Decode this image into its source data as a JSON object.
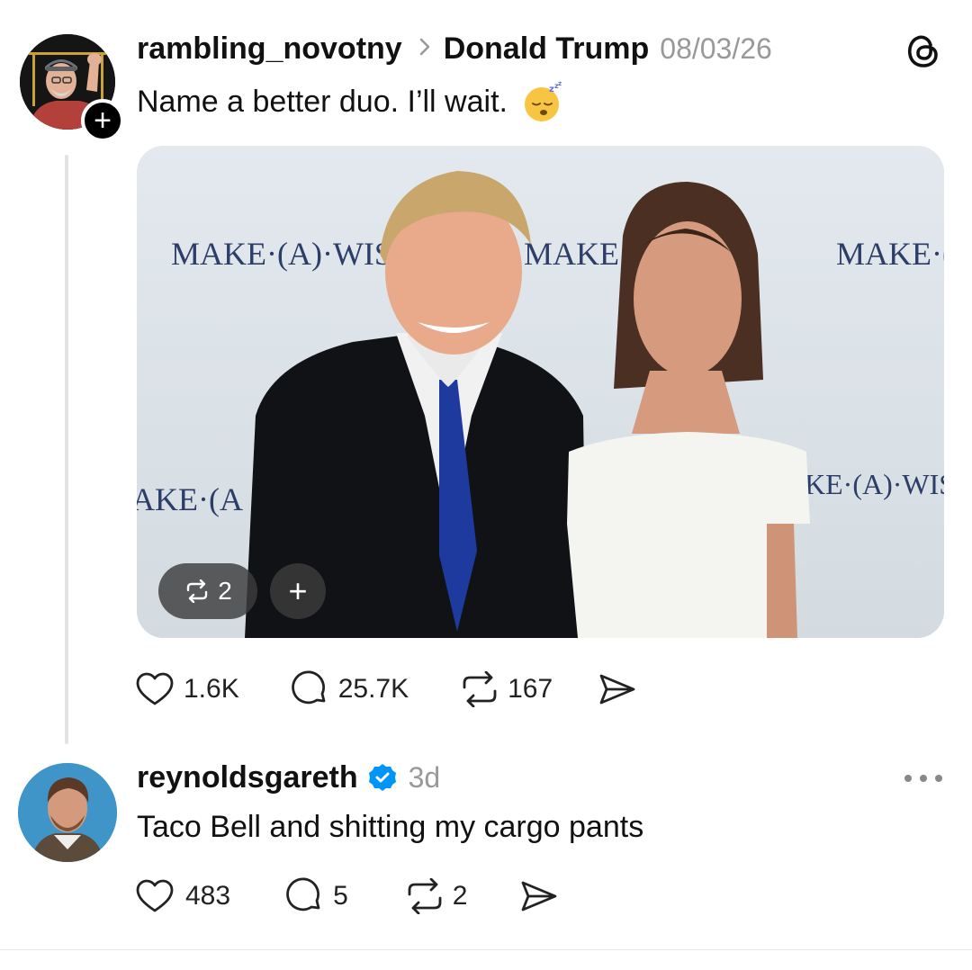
{
  "post": {
    "username": "rambling_novotny",
    "reply_to": "Donald Trump",
    "timestamp": "08/03/26",
    "text": "Name a better duo. I’ll wait.",
    "emoji": "sleeping-face",
    "media": {
      "backdrop_text": [
        "MAKE·(A)·WIS",
        "MAKE·(",
        "MAKE·(A",
        "AKE·(A",
        "KE·(A)·WISI"
      ],
      "repost_count": "2"
    },
    "actions": {
      "likes": "1.6K",
      "replies": "25.7K",
      "reposts": "167"
    }
  },
  "reply": {
    "username": "reynoldsgareth",
    "verified": true,
    "timestamp": "3d",
    "text": "Taco Bell and shitting my cargo pants",
    "actions": {
      "likes": "483",
      "replies": "5",
      "reposts": "2"
    }
  },
  "icons": [
    "heart-icon",
    "comment-icon",
    "repost-icon",
    "send-icon",
    "threads-logo-icon",
    "verified-icon",
    "more-icon",
    "plus-icon"
  ],
  "colors": {
    "accent_verified": "#0095f6",
    "muted": "#999999",
    "text": "#111111"
  }
}
